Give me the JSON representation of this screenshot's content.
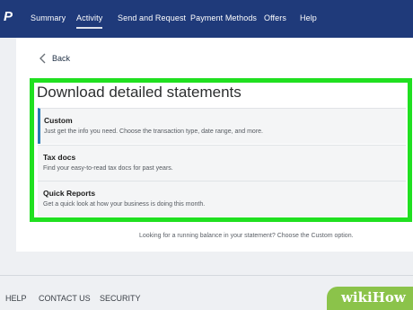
{
  "nav": {
    "logo": "P",
    "items": [
      {
        "label": "Summary"
      },
      {
        "label": "Activity"
      },
      {
        "label": "Send and Request"
      },
      {
        "label": "Payment Methods"
      },
      {
        "label": "Offers"
      },
      {
        "label": "Help"
      }
    ],
    "active_index": 1
  },
  "back": {
    "label": "Back"
  },
  "panel": {
    "title": "Download detailed statements",
    "options": [
      {
        "label": "Custom",
        "description": "Just get the info you need. Choose the transaction type, date range, and more."
      },
      {
        "label": "Tax docs",
        "description": "Find your easy-to-read tax docs for past years."
      },
      {
        "label": "Quick Reports",
        "description": "Get a quick look at how your business is doing this month."
      }
    ]
  },
  "hint": "Looking for a running balance in your statement? Choose the Custom option.",
  "footer": {
    "links": [
      {
        "label": "HELP"
      },
      {
        "label": "CONTACT US"
      },
      {
        "label": "SECURITY"
      }
    ]
  },
  "watermark": "wikiHow",
  "colors": {
    "nav_bg": "#1f3a7a",
    "highlight": "#20e020",
    "selected_accent": "#2a7ab5"
  }
}
